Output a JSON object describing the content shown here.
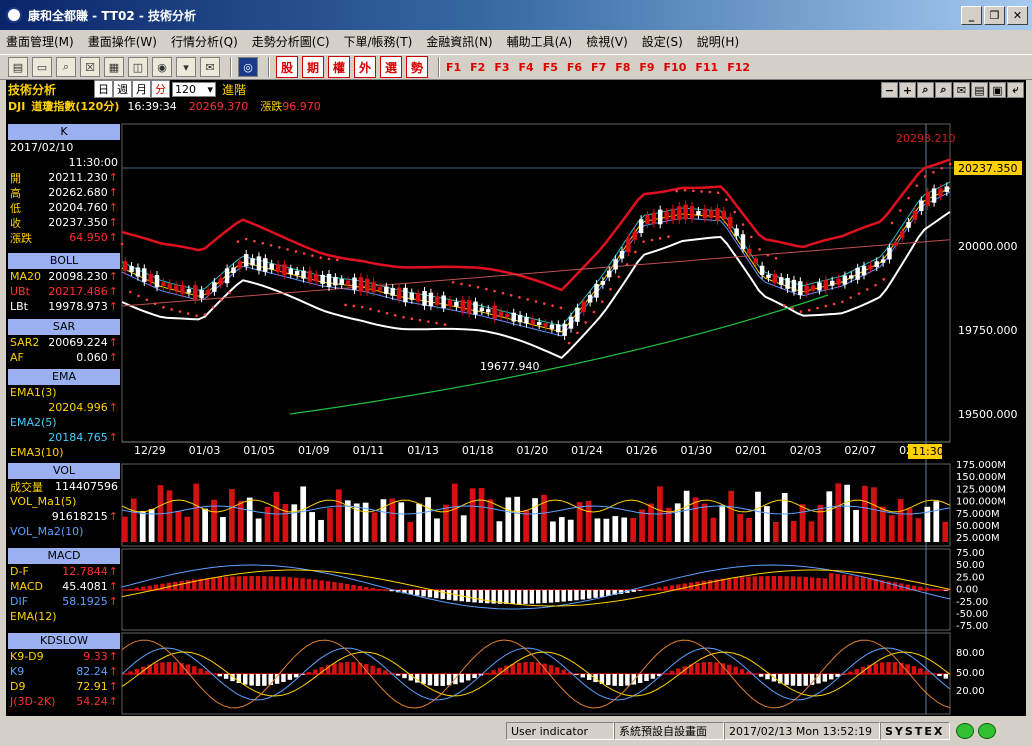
{
  "window": {
    "title": "康和全都賺 - TT02 - 技術分析",
    "minimize": "_",
    "restore": "❐",
    "close": "✕"
  },
  "menu": [
    "畫面管理(M)",
    "畫面操作(W)",
    "行情分析(Q)",
    "走勢分析圖(C)",
    "下單/帳務(T)",
    "金融資訊(N)",
    "輔助工具(A)",
    "檢視(V)",
    "設定(S)",
    "說明(H)"
  ],
  "toolbar": {
    "red_buttons": [
      "股",
      "期",
      "權",
      "外",
      "選",
      "勢"
    ],
    "fkeys": [
      "F1",
      "F2",
      "F3",
      "F4",
      "F5",
      "F6",
      "F7",
      "F8",
      "F9",
      "F10",
      "F11",
      "F12"
    ]
  },
  "chart_header": {
    "title": "技術分析",
    "periods": [
      "日",
      "週",
      "月",
      "分"
    ],
    "period_count": "120",
    "mode": "進階",
    "symbol": "DJI",
    "name": "道瓊指數(120分)",
    "time": "16:39:34",
    "price": "20269.370",
    "change_label": "漲跌",
    "change": "96.970",
    "buttons": [
      "−",
      "+",
      "⌕",
      "⌕",
      "✉",
      "▤",
      "▣",
      "⤶"
    ]
  },
  "left_panel": {
    "k": {
      "header": "K",
      "date": "2017/02/10",
      "time": "11:30:00",
      "rows": [
        [
          "開",
          "20211.230"
        ],
        [
          "高",
          "20262.680"
        ],
        [
          "低",
          "20204.760"
        ],
        [
          "收",
          "20237.350"
        ],
        [
          "漲跌",
          "64.950"
        ]
      ]
    },
    "boll": {
      "header": "BOLL",
      "rows": [
        [
          "MA20",
          "20098.230"
        ],
        [
          "UBt",
          "20217.486"
        ],
        [
          "LBt",
          "19978.973"
        ]
      ]
    },
    "sar": {
      "header": "SAR",
      "rows": [
        [
          "SAR2",
          "20069.224"
        ],
        [
          "AF",
          "0.060"
        ]
      ]
    },
    "ema": {
      "header": "EMA",
      "ema1_label": "EMA1(3)",
      "ema1_value": "20204.996",
      "ema2_label": "EMA2(5)",
      "ema2_value": "20184.765",
      "ema3_label": "EMA3(10)"
    },
    "vol": {
      "header": "VOL",
      "row1_label": "成交量",
      "row1_value": "114407596",
      "ma1_label": "VOL_Ma1(5)",
      "ma1_value": "91618215",
      "ma2_label": "VOL_Ma2(10)"
    },
    "macd": {
      "header": "MACD",
      "rows": [
        [
          "D-F",
          "12.7844"
        ],
        [
          "MACD",
          "45.4081"
        ],
        [
          "DIF",
          "58.1925"
        ]
      ],
      "ema_label": "EMA(12)"
    },
    "kd": {
      "header": "KDSLOW",
      "rows": [
        [
          "K9-D9",
          "9.33"
        ],
        [
          "K9",
          "82.24"
        ],
        [
          "D9",
          "72.91"
        ],
        [
          "J(3D-2K)",
          "54.24"
        ]
      ]
    }
  },
  "price_chart": {
    "y_ticks": [
      "20000.000",
      "19750.000",
      "19500.000"
    ],
    "current_price_tag": "20237.350",
    "high_label": "20293.210",
    "low_label": "19677.940",
    "x_ticks": [
      "12/29",
      "01/03",
      "01/05",
      "01/09",
      "01/11",
      "01/13",
      "01/18",
      "01/20",
      "01/24",
      "01/26",
      "01/30",
      "02/01",
      "02/03",
      "02/07",
      "02/0"
    ],
    "cursor_time": "11:30"
  },
  "vol_chart": {
    "y_ticks": [
      "175.000M",
      "150.000M",
      "125.000M",
      "100.000M",
      "75.000M",
      "50.000M",
      "25.000M"
    ]
  },
  "macd_chart": {
    "y_ticks": [
      "75.00",
      "50.00",
      "25.00",
      "0.00",
      "-25.00",
      "-50.00",
      "-75.00"
    ]
  },
  "kd_chart": {
    "y_ticks": [
      "80.00",
      "50.00",
      "20.00"
    ]
  },
  "status": {
    "indicator": "User indicator",
    "layout": "系統預設自設畫面",
    "datetime": "2017/02/13 Mon 13:52:19",
    "brand": "SYSTEX"
  },
  "colors": {
    "up": "#d41010",
    "down": "#ffffff",
    "boll": "#e01020",
    "sar": "#ff4040",
    "ma_long": "#20c040",
    "bg": "#000000"
  }
}
